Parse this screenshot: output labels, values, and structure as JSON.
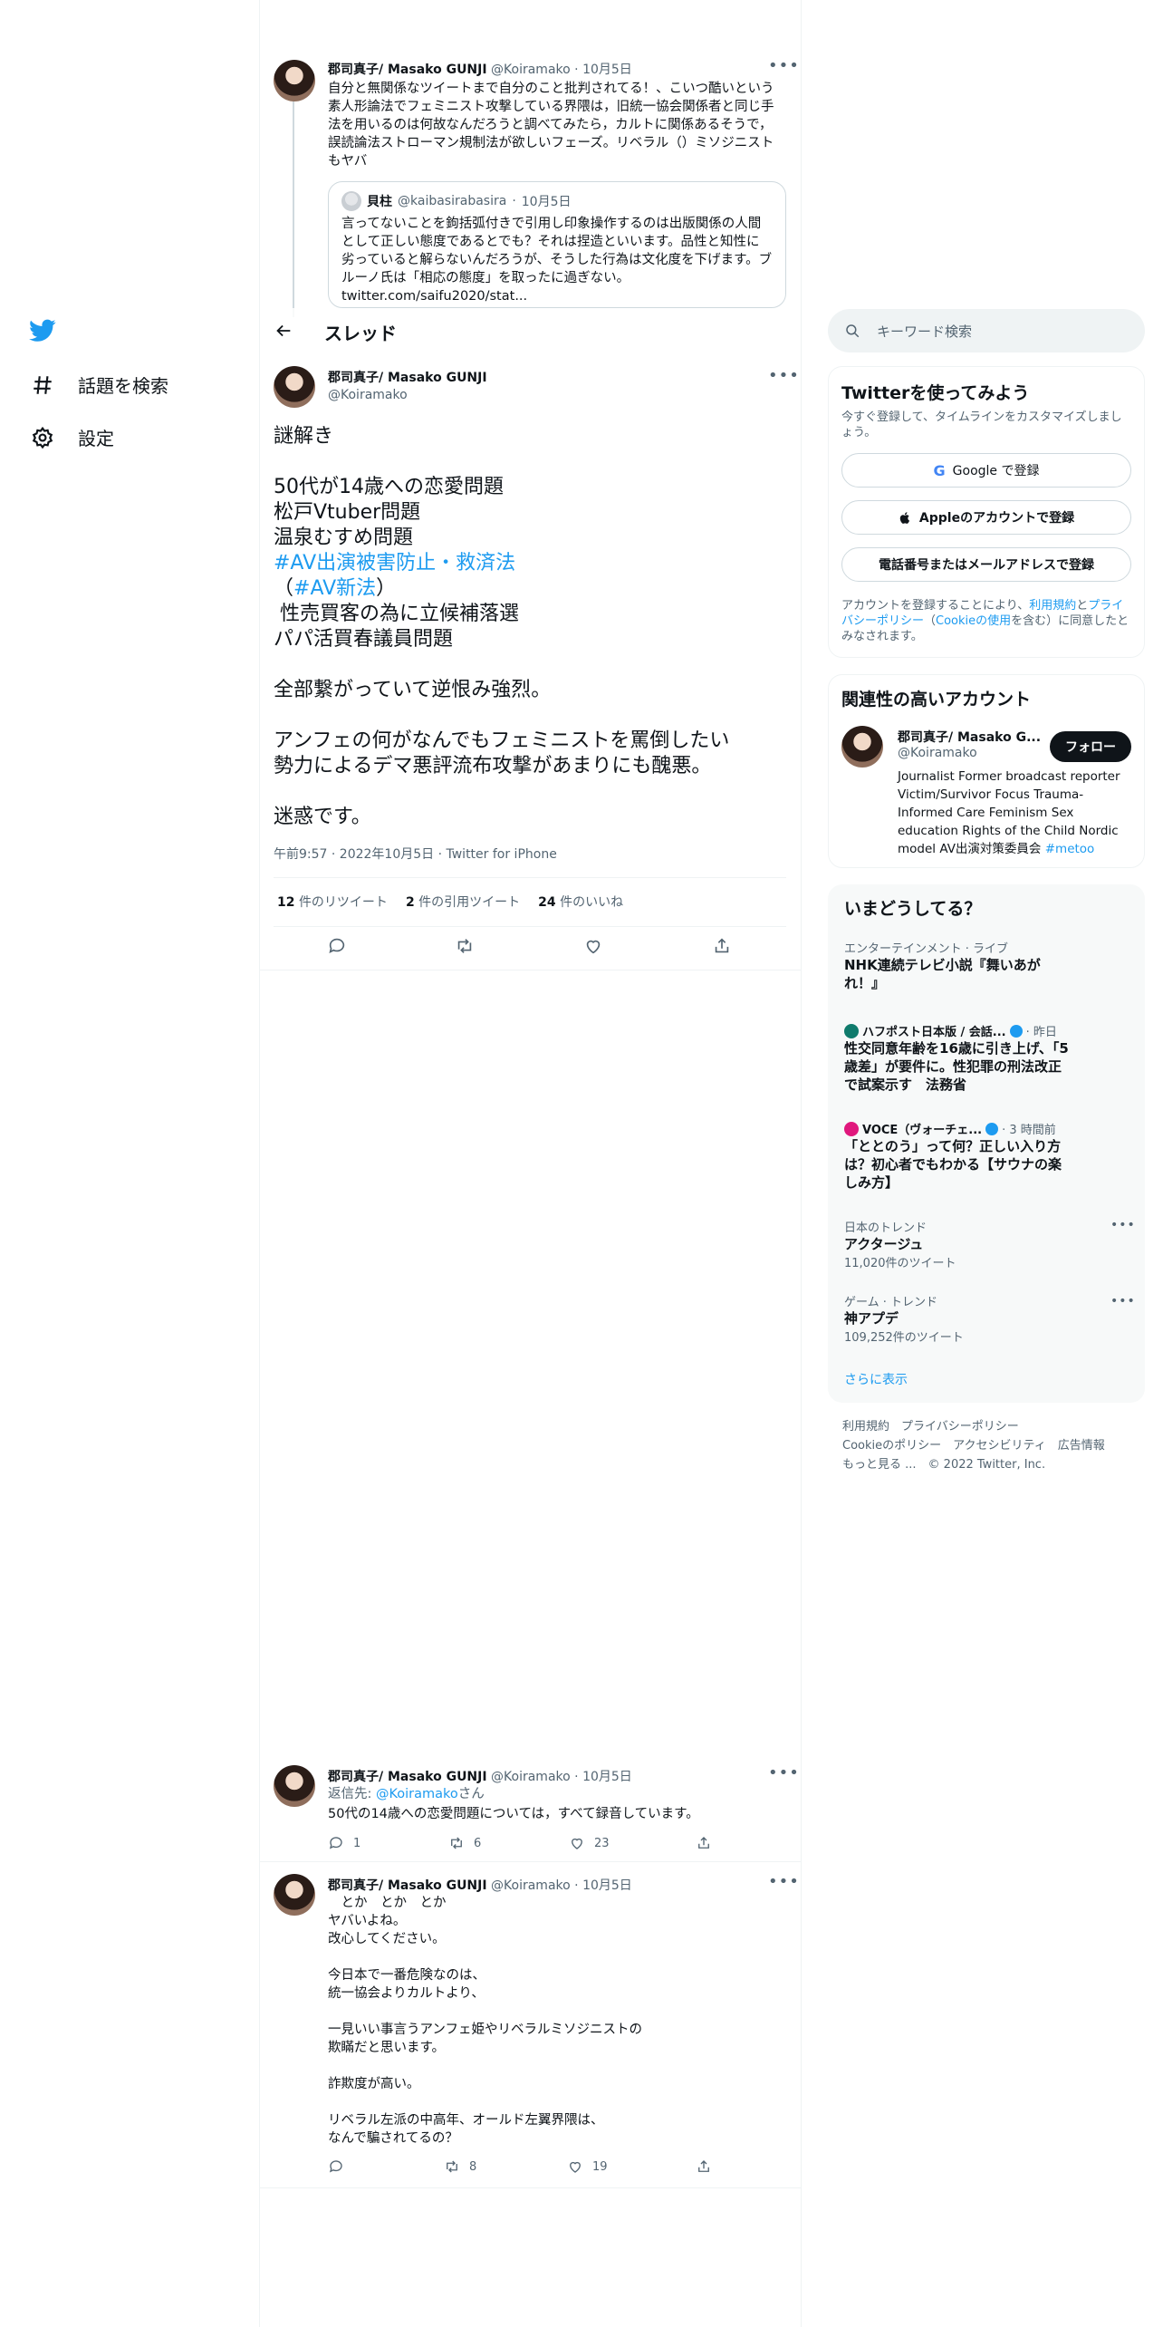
{
  "nav": {
    "explore_label": "話題を検索",
    "settings_label": "設定"
  },
  "thread_header": {
    "title": "スレッド"
  },
  "prev_tweet": {
    "name": "郡司真子/ Masako GUNJI",
    "handle": "@Koiramako",
    "date": "10月5日",
    "text": "自分と無関係なツイートまで自分のこと批判されてる！、こいつ酷いという素人形論法でフェミニスト攻撃している界隈は，旧統一協会関係者と同じ手法を用いるのは何故なんだろうと調べてみたら，カルトに関係あるそうで，誤読論法ストローマン規制法が欲しいフェーズ。リベラル（）ミソジニストもヤバ",
    "quote": {
      "name": "貝柱",
      "handle": "@kaibasirabasira",
      "date": "10月5日",
      "text": "言ってないことを鉤括弧付きで引用し印象操作するのは出版関係の人間として正しい態度であるとでも？それは捏造といいます。品性と知性に劣っていると解らないんだろうが、そうした行為は文化度を下げます。ブルーノ氏は「相応の態度」を取ったに過ぎない。",
      "link": "twitter.com/saifu2020/stat..."
    }
  },
  "main_tweet": {
    "name": "郡司真子/ Masako GUNJI",
    "handle": "@Koiramako",
    "lines": {
      "l1": "謎解き",
      "l2": "50代が14歳への恋愛問題",
      "l3": "松戸Vtuber問題",
      "l4": "温泉むすめ問題",
      "l5_tag": "#AV出演被害防止・救済法",
      "l6_pre": "（",
      "l6_tag": "#AV新法",
      "l6_post": "）",
      "l7": " 性売買客の為に立候補落選",
      "l8": "パパ活買春議員問題",
      "l9": "全部繋がっていて逆恨み強烈。",
      "l10": "アンフェの何がなんでもフェミニストを罵倒したい",
      "l11": "勢力によるデマ悪評流布攻撃があまりにも醜悪。",
      "l12": "迷惑です。"
    },
    "timestamp": "午前9:57 · 2022年10月5日 · Twitter for iPhone",
    "stats": {
      "retweets_count": "12",
      "retweets_label": "件のリツイート",
      "quotes_count": "2",
      "quotes_label": "件の引用ツイート",
      "likes_count": "24",
      "likes_label": "件のいいね"
    }
  },
  "replies": [
    {
      "name": "郡司真子/ Masako GUNJI",
      "handle": "@Koiramako",
      "date": "10月5日",
      "reply_to_prefix": "返信先: ",
      "reply_to_handle": "@Koiramako",
      "reply_to_suffix": "さん",
      "text": "50代の14歳への恋愛問題については，すべて録音しています。",
      "reply_count": "1",
      "retweet_count": "6",
      "like_count": "23"
    },
    {
      "name": "郡司真子/ Masako GUNJI",
      "handle": "@Koiramako",
      "date": "10月5日",
      "text": "　とか　とか　とか\nヤバいよね。\n改心してください。\n\n今日本で一番危険なのは、\n統一協会よりカルトより、\n\n一見いい事言うアンフェ姫やリベラルミソジニストの\n欺瞞だと思います。\n\n詐欺度が高い。\n\nリベラル左派の中高年、オールド左翼界隈は、\nなんで騙されてるの？",
      "reply_count": "",
      "retweet_count": "8",
      "like_count": "19"
    }
  ],
  "sidebar": {
    "search_placeholder": "キーワード検索",
    "signup": {
      "title": "Twitterを使ってみよう",
      "subtitle": "今すぐ登録して、タイムラインをカスタマイズしましょう。",
      "google_btn": "Google で登録",
      "apple_btn": "Appleのアカウントで登録",
      "phone_btn": "電話番号またはメールアドレスで登録",
      "legal_1": "アカウントを登録することにより、",
      "legal_terms": "利用規約",
      "legal_2": "と",
      "legal_privacy": "プライバシーポリシー",
      "legal_3": "（",
      "legal_cookie": "Cookieの使用",
      "legal_4": "を含む）に同意したとみなされます。"
    },
    "related": {
      "title": "関連性の高いアカウント",
      "name": "郡司真子/ Masako G...",
      "handle": "@Koiramako",
      "follow": "フォロー",
      "bio": "Journalist Former broadcast reporter Victim/Survivor Focus Trauma-Informed Care Feminism Sex education Rights of the Child Nordic model AV出演対策委員会 ",
      "bio_tag": "#metoo"
    },
    "trends": {
      "title": "いまどうしてる？",
      "items": [
        {
          "category": "エンターテインメント · ライブ",
          "title": "NHK連続テレビ小説『舞いあがれ！』"
        },
        {
          "source": "ハフポスト日本版 / 会話...",
          "time": "· 昨日",
          "title": "性交同意年齢を16歳に引き上げ、「5歳差」が要件に。性犯罪の刑法改正で試案示す　法務省"
        },
        {
          "source": "VOCE（ヴォーチェ...",
          "time": "· 3 時間前",
          "title": "「ととのう」って何？正しい入り方は？初心者でもわかる【サウナの楽しみ方】"
        },
        {
          "category": "日本のトレンド",
          "title": "アクタージュ",
          "count": "11,020件のツイート"
        },
        {
          "category": "ゲーム · トレンド",
          "title": "神アプデ",
          "count": "109,252件のツイート"
        }
      ],
      "show_more": "さらに表示"
    },
    "footer": {
      "terms": "利用規約",
      "privacy": "プライバシーポリシー",
      "cookie": "Cookieのポリシー",
      "accessibility": "アクセシビリティ",
      "ads": "広告情報",
      "more": "もっと見る ...",
      "copyright": "© 2022 Twitter, Inc."
    }
  },
  "colors": {
    "accent": "#1d9bf0",
    "text": "#0f1419",
    "muted": "#536471"
  }
}
